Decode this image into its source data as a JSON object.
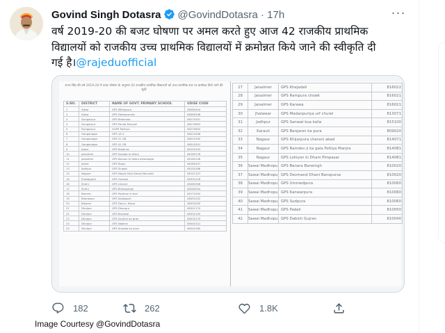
{
  "tweet": {
    "name": "Govind Singh Dotasra",
    "handle": "@GovindDotasra",
    "separator": "·",
    "time": "17h",
    "more": "···",
    "text_line1": "वर्ष 2019-20 की बजट घोषणा पर अमल करते हुए आज 42 राजकीय प्राथमिक",
    "text_line2": "विद्यालयों को राजकीय उच्च प्राथमिक विद्यालयों में क्रमोन्नत किये जाने की स्वीकृति दी",
    "text_line3": "गई है।",
    "mention": "@rajeduofficial"
  },
  "document": {
    "left_title": "राज्य सिंह की वर्ष 2019-20 में बजट घोषणा के अनुसार 42 राजकीय प्राथमिक विद्यालयों को उच्च प्राथमिक स्तर पर क्रमोन्नत किये जाने की सूची",
    "left_headers": [
      "S.NO.",
      "DISTRICT",
      "NAME OF GOVT. PRIMARY SCHOOL",
      "UDISE CODE"
    ],
    "left_rows": [
      [
        "1",
        "Alwar",
        "GPS Mithapura",
        "08080404"
      ],
      [
        "2",
        "Alwar",
        "GPS Fatehpurnda",
        "08080508"
      ],
      [
        "3",
        "Dungarpur",
        "GPS Bholavda",
        "08270301"
      ],
      [
        "4",
        "Dungarpur",
        "GPS Panda Dariyali",
        "08270603"
      ],
      [
        "5",
        "Dungarpur",
        "GUPS Padriya",
        "08270604"
      ],
      [
        "6",
        "Ganganagar",
        "GPS 18 Z",
        "08010306"
      ],
      [
        "7",
        "Ganganagar",
        "GPS 31 GB",
        "08010305"
      ],
      [
        "8",
        "Ganganagar",
        "GPS 41 GB",
        "08010301"
      ],
      [
        "9",
        "Jaipur",
        "GPS Balipura",
        "08120102"
      ],
      [
        "10",
        "Jaisalmer",
        "GPS Sasada ki dhani",
        "08160176"
      ],
      [
        "11",
        "Jaisalmer",
        "GPS Kesuan ki dhani amarsagar",
        "08160128"
      ],
      [
        "12",
        "Jalore",
        "GPS Rajan",
        "08180437"
      ],
      [
        "13",
        "Jodhpur",
        "GPS Singda",
        "08150166"
      ],
      [
        "14",
        "Nagaur",
        "GPS Nayak Dhal Dhani Bhundel",
        "08141107"
      ],
      [
        "15",
        "Pratapgarh",
        "GPS Gulawa",
        "08331216"
      ],
      [
        "16",
        "Sirohi",
        "GPS Umarni",
        "08260306"
      ],
      [
        "17",
        "Sirohi",
        "GPS Bhesapingh",
        "08260304"
      ],
      [
        "18",
        "Barmer",
        "GPS Peethon ki beri",
        "08171004"
      ],
      [
        "19",
        "Bharatpur",
        "GPS Sakalgarh",
        "08050102"
      ],
      [
        "20",
        "Bikaner",
        "GPS Dauru, Kesar",
        "08030200"
      ],
      [
        "21",
        "Dholpur",
        "GPS Dhanpur",
        "08301174"
      ],
      [
        "22",
        "Dholpur",
        "GPS Barawal",
        "08302155"
      ],
      [
        "23",
        "Dholpur",
        "GPS Sankhe ka ghar",
        "08030170"
      ],
      [
        "24",
        "Dholpur",
        "GPS Nadera",
        "08040101"
      ],
      [
        "25",
        "Dholpur",
        "GPS Khadda ka pura",
        "08040160"
      ]
    ],
    "right_rows": [
      [
        "27",
        "Jaisalmer",
        "GPS Khejadali",
        "816022"
      ],
      [
        "28",
        "Jaisalmer",
        "GPS Rampura chowk",
        "816021"
      ],
      [
        "29",
        "Jaisalmer",
        "GPS Karawa",
        "816021"
      ],
      [
        "30",
        "Jhalawar",
        "GPS Madanpuriya urf churel",
        "813071"
      ],
      [
        "31",
        "Jodhpur",
        "GPS Sanwat kua kalla",
        "815100"
      ],
      [
        "32",
        "Karauli",
        "GPS Banjaron ka pura",
        "809020"
      ],
      [
        "33",
        "Nagaur",
        "GPS Khijarpura cherani abad",
        "814071"
      ],
      [
        "34",
        "Nagaur",
        "GPS Ramdev ji ka gala Potliya Manjra",
        "814081"
      ],
      [
        "35",
        "Nagaur",
        "GPS Lohiyon ki Dhani Pimpasar",
        "814081"
      ],
      [
        "36",
        "Sawai Madhopur",
        "GPS Banara Baneingh",
        "810020"
      ],
      [
        "37",
        "Sawai Madhopur",
        "GPS Devmand Dhani Banspursa",
        "810020"
      ],
      [
        "38",
        "Sawai Madhopur",
        "GPS Ummedpura",
        "810060"
      ],
      [
        "39",
        "Sawai Madhopur",
        "GPS Kanwarpura",
        "810060"
      ],
      [
        "40",
        "Sawai Madhopur",
        "GPS Sudpura",
        "810060"
      ],
      [
        "41",
        "Sawai Madhopur",
        "GPS Padali",
        "810050"
      ],
      [
        "42",
        "Sawai Madhopur",
        "GPS Dabich Gujran",
        "810040"
      ]
    ]
  },
  "actions": {
    "replies": "182",
    "retweets": "262",
    "likes": "1.8K"
  },
  "icons": {
    "verified": "verified-badge-icon",
    "reply": "reply-icon",
    "retweet": "retweet-icon",
    "like": "heart-icon",
    "share": "share-icon"
  },
  "colors": {
    "link": "#1d9bf0",
    "secondary_text": "#536471",
    "verified": "#1d9bf0"
  },
  "credit": "Image Courtesy @GovindDotasra"
}
